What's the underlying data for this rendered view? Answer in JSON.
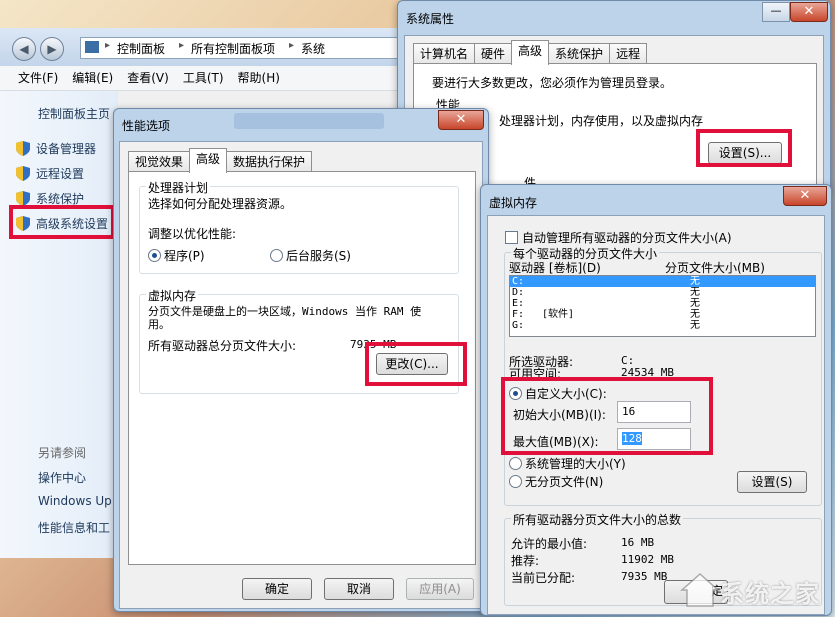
{
  "explorer": {
    "breadcrumb": [
      "控制面板",
      "所有控制面板项",
      "系统"
    ],
    "menu": [
      "文件(F)",
      "编辑(E)",
      "查看(V)",
      "工具(T)",
      "帮助(H)"
    ],
    "sidebar_home": "控制面板主页",
    "sidebar_items": [
      "设备管理器",
      "远程设置",
      "系统保护",
      "高级系统设置"
    ],
    "see_also_title": "另请参阅",
    "see_also": [
      "操作中心",
      "Windows Up",
      "性能信息和工"
    ]
  },
  "sysprops": {
    "title": "系统属性",
    "tabs": [
      "计算机名",
      "硬件",
      "高级",
      "系统保护",
      "远程"
    ],
    "admin_note": "要进行大多数更改，您必须作为管理员登录。",
    "perf_group": "性能",
    "perf_desc": "处理器计划，内存使用，以及虚拟内存",
    "settings_button": "设置(S)...",
    "partial_label": "件"
  },
  "perfopts": {
    "title": "性能选项",
    "tabs": [
      "视觉效果",
      "高级",
      "数据执行保护"
    ],
    "cpu_group": "处理器计划",
    "cpu_desc": "选择如何分配处理器资源。",
    "optimize_label": "调整以优化性能:",
    "opt_programs": "程序(P)",
    "opt_background": "后台服务(S)",
    "vm_group": "虚拟内存",
    "vm_desc": "分页文件是硬盘上的一块区域，Windows 当作 RAM 使用。",
    "vm_total_label": "所有驱动器总分页文件大小:",
    "vm_total_value": "7935 MB",
    "change_button": "更改(C)...",
    "ok": "确定",
    "cancel": "取消",
    "apply": "应用(A)"
  },
  "virtmem": {
    "title": "虚拟内存",
    "auto_manage": "自动管理所有驱动器的分页文件大小(A)",
    "per_drive_group": "每个驱动器的分页文件大小",
    "col_drive": "驱动器 [卷标](D)",
    "col_size": "分页文件大小(MB)",
    "drives": [
      {
        "drive": "C:",
        "label": "",
        "size": "无"
      },
      {
        "drive": "D:",
        "label": "",
        "size": "无"
      },
      {
        "drive": "E:",
        "label": "",
        "size": "无"
      },
      {
        "drive": "F:",
        "label": "[软件]",
        "size": "无"
      },
      {
        "drive": "G:",
        "label": "",
        "size": "无"
      }
    ],
    "selected_drive_label": "所选驱动器:",
    "selected_drive_value": "C:",
    "free_space_label": "可用空间:",
    "free_space_value": "24534 MB",
    "custom_size": "自定义大小(C):",
    "initial_label": "初始大小(MB)(I):",
    "initial_value": "16",
    "max_label": "最大值(MB)(X):",
    "max_value": "128",
    "system_managed": "系统管理的大小(Y)",
    "no_paging": "无分页文件(N)",
    "set_button": "设置(S)",
    "total_group": "所有驱动器分页文件大小的总数",
    "min_label": "允许的最小值:",
    "min_value": "16 MB",
    "recommended_label": "推荐:",
    "recommended_value": "11902 MB",
    "allocated_label": "当前已分配:",
    "allocated_value": "7935 MB",
    "ok_partial": "定"
  },
  "watermark": "系统之家",
  "colors": {
    "highlight": "#e0103a",
    "selection": "#3399ff"
  }
}
